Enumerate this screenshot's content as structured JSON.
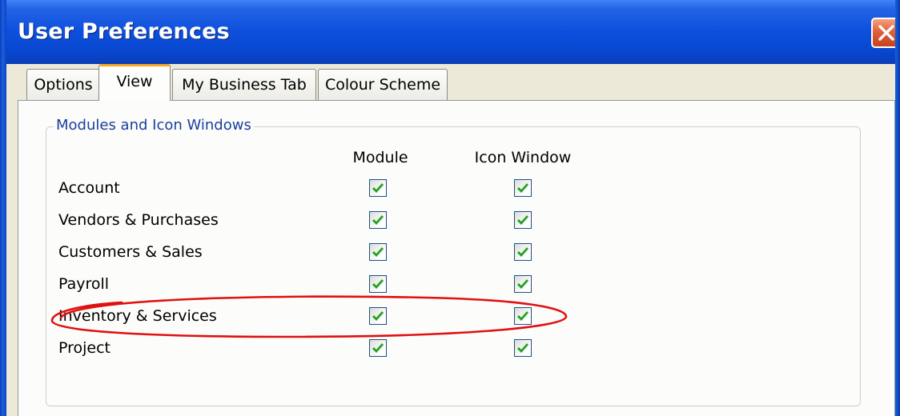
{
  "window": {
    "title": "User Preferences"
  },
  "tabs": [
    {
      "label": "Options",
      "active": false
    },
    {
      "label": "View",
      "active": true
    },
    {
      "label": "My Business Tab",
      "active": false
    },
    {
      "label": "Colour Scheme",
      "active": false
    }
  ],
  "group": {
    "legend": "Modules and Icon Windows",
    "columns": [
      "Module",
      "Icon Window"
    ],
    "rows": [
      {
        "label": "Account",
        "module": true,
        "icon_window": true
      },
      {
        "label": "Vendors & Purchases",
        "module": true,
        "icon_window": true
      },
      {
        "label": "Customers & Sales",
        "module": true,
        "icon_window": true
      },
      {
        "label": "Payroll",
        "module": true,
        "icon_window": true
      },
      {
        "label": "Inventory & Services",
        "module": true,
        "icon_window": true
      },
      {
        "label": "Project",
        "module": true,
        "icon_window": true
      }
    ]
  },
  "icons": {
    "close": "close-x-icon",
    "check": "checkmark-icon"
  },
  "colors": {
    "titlebar": "#0846cf",
    "legend_text": "#1a3f9e",
    "active_tab_accent": "#f5a623",
    "checkmark": "#21a121",
    "annotation": "#e01010"
  }
}
